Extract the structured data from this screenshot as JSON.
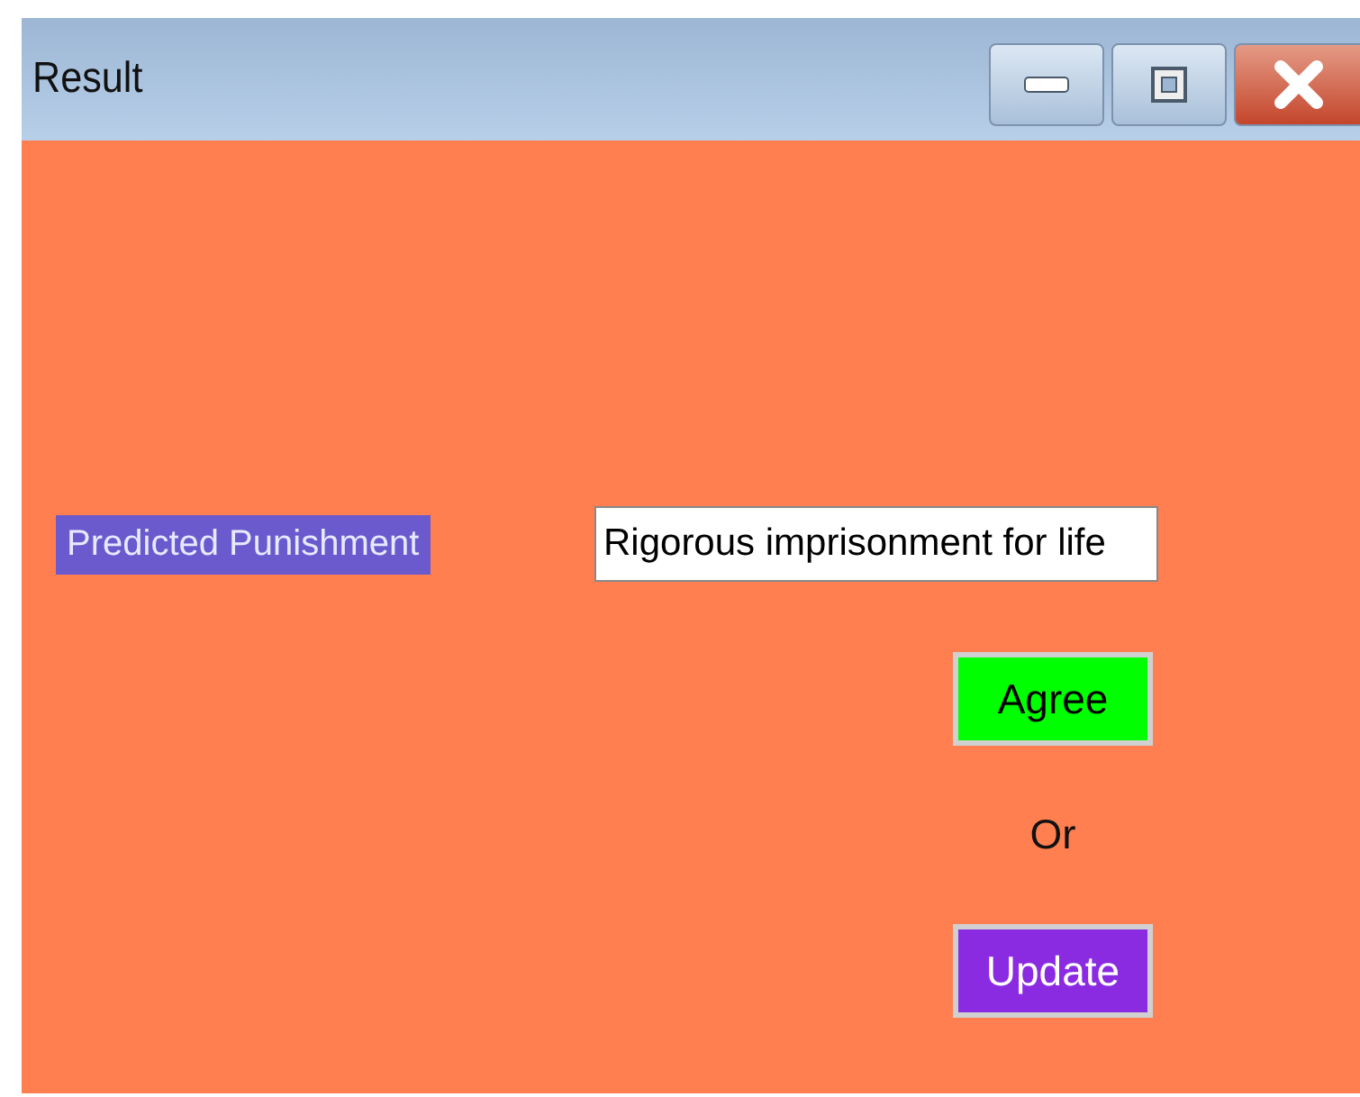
{
  "window": {
    "title": "Result"
  },
  "field": {
    "label": "Predicted Punishment",
    "value": "Rigorous imprisonment for life"
  },
  "actions": [
    {
      "kind": "button",
      "label": "Agree",
      "color": "#00ff00"
    },
    {
      "kind": "text",
      "label": "Or"
    },
    {
      "kind": "button",
      "label": "Update",
      "color": "#8a2be2"
    }
  ]
}
